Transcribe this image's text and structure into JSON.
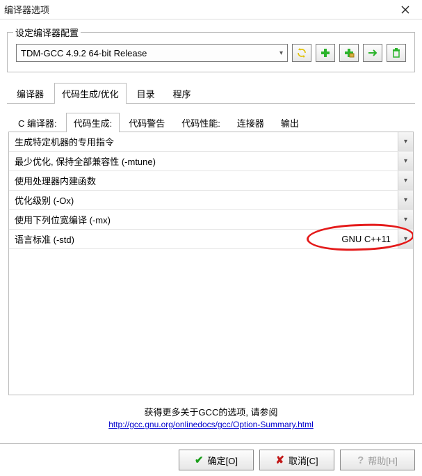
{
  "window": {
    "title": "编译器选项"
  },
  "config": {
    "group_label": "设定编译器配置",
    "selected": "TDM-GCC 4.9.2 64-bit Release",
    "icons": [
      "find-replace-icon",
      "add-icon",
      "add-folder-icon",
      "rename-icon",
      "delete-icon"
    ]
  },
  "tabs_main": {
    "items": [
      "编译器",
      "代码生成/优化",
      "目录",
      "程序"
    ],
    "active_index": 1
  },
  "tabs_sub": {
    "items": [
      "C 编译器:",
      "代码生成:",
      "代码警告",
      "代码性能:",
      "连接器",
      "输出"
    ],
    "active_index": 1
  },
  "options": [
    {
      "label": "生成特定机器的专用指令",
      "value": ""
    },
    {
      "label": "最少优化, 保持全部兼容性 (-mtune)",
      "value": ""
    },
    {
      "label": "使用处理器内建函数",
      "value": ""
    },
    {
      "label": "优化级别 (-Ox)",
      "value": ""
    },
    {
      "label": "使用下列位宽编译 (-mx)",
      "value": ""
    },
    {
      "label": "语言标准 (-std)",
      "value": "GNU C++11",
      "highlight": true
    }
  ],
  "footer": {
    "text": "获得更多关于GCC的选项, 请参阅",
    "link_text": "http://gcc.gnu.org/onlinedocs/gcc/Option-Summary.html"
  },
  "buttons": {
    "ok": "确定[O]",
    "cancel": "取消[C]",
    "help": "帮助[H]"
  }
}
